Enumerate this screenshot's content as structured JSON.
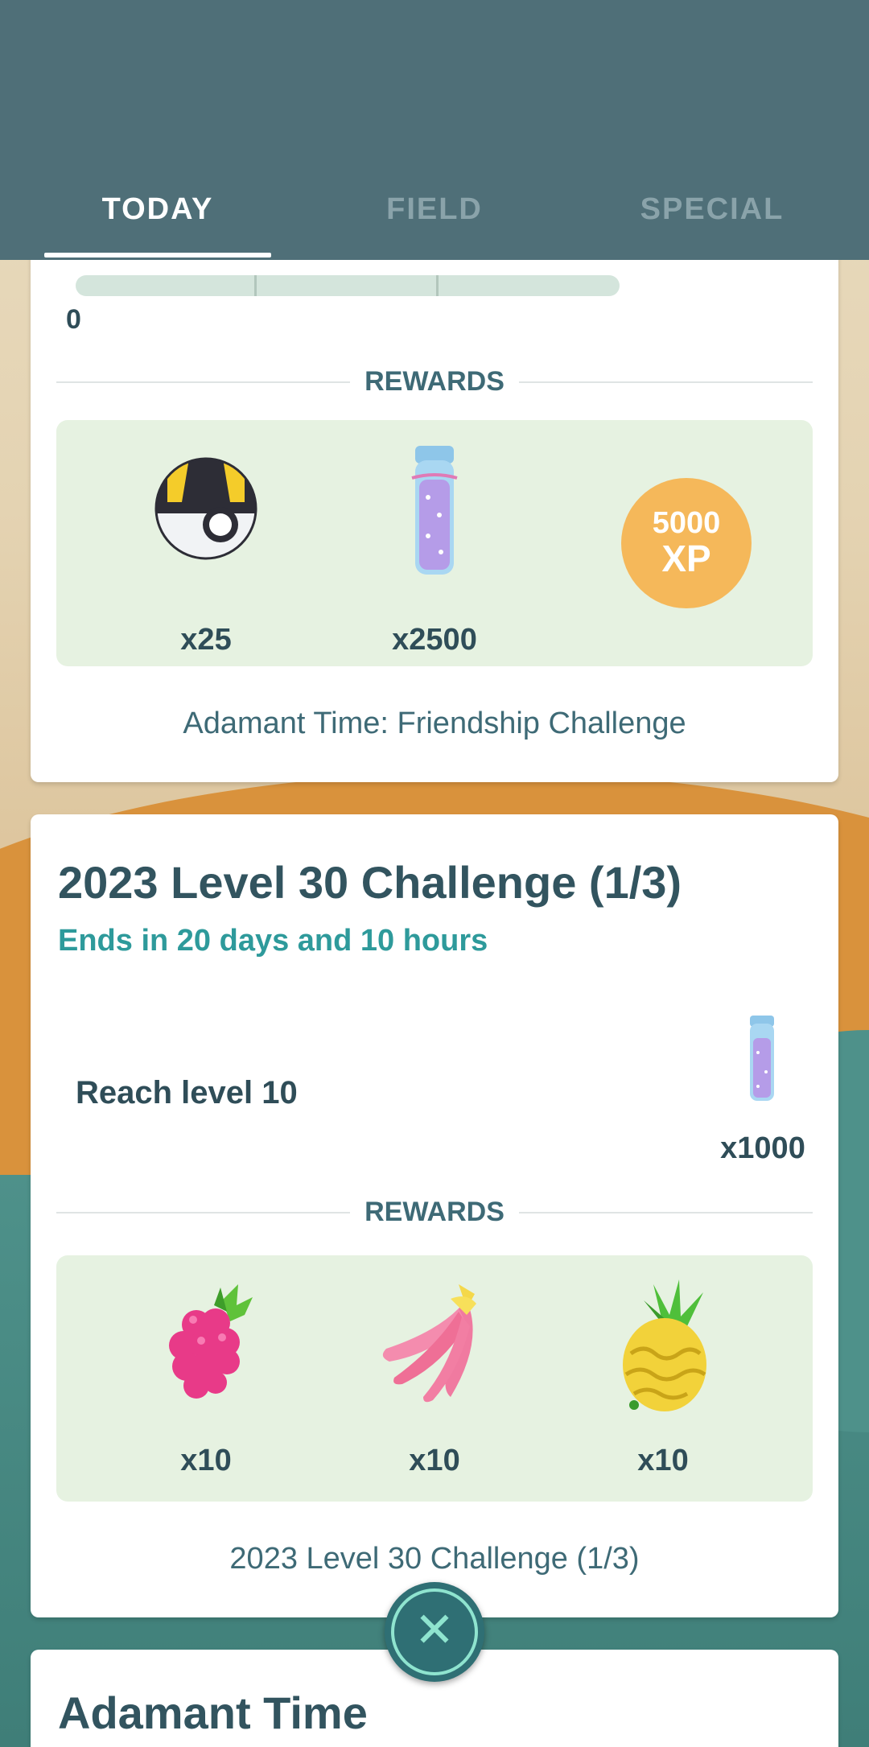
{
  "tabs": [
    {
      "label": "TODAY",
      "active": true
    },
    {
      "label": "FIELD",
      "active": false
    },
    {
      "label": "SPECIAL",
      "active": false
    }
  ],
  "card1": {
    "progress_start": "0",
    "rewards_label": "REWARDS",
    "rewards": [
      {
        "icon": "ultra-ball-icon",
        "qty": "x25"
      },
      {
        "icon": "stardust-icon",
        "qty": "x2500"
      },
      {
        "icon": "xp-coin-icon",
        "xp_amount": "5000",
        "xp_unit": "XP"
      }
    ],
    "top_coin_label": "XP",
    "footer": "Adamant Time: Friendship Challenge"
  },
  "card2": {
    "title": "2023 Level 30 Challenge (1/3)",
    "subtitle": "Ends in 20 days and 10 hours",
    "task": {
      "label": "Reach level 10",
      "reward_icon": "stardust-icon",
      "reward_qty": "x1000"
    },
    "rewards_label": "REWARDS",
    "rewards": [
      {
        "icon": "razz-berry-icon",
        "qty": "x10"
      },
      {
        "icon": "nanab-berry-icon",
        "qty": "x10"
      },
      {
        "icon": "pinap-berry-icon",
        "qty": "x10"
      }
    ],
    "footer": "2023 Level 30 Challenge (1/3)"
  },
  "card3": {
    "title": "Adamant Time"
  },
  "colors": {
    "header": "#4f6f78",
    "accent_teal": "#2e9a9b",
    "reward_bg": "#e6f2e1",
    "xp_coin": "#f5b85a"
  }
}
